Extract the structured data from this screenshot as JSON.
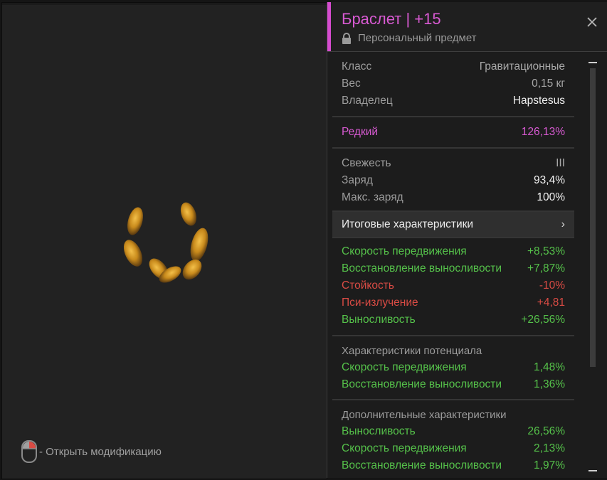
{
  "viewer": {
    "hint_text": "- Открыть модификацию"
  },
  "item": {
    "title": "Браслет | +15",
    "subtitle": "Персональный предмет"
  },
  "info": [
    {
      "label": "Класс",
      "value": "Гравитационные"
    },
    {
      "label": "Вес",
      "value": "0,15 кг"
    },
    {
      "label": "Владелец",
      "value": "Hapstesus"
    }
  ],
  "rarity": {
    "label": "Редкий",
    "value": "126,13%"
  },
  "condition": [
    {
      "label": "Свежесть",
      "value": "III"
    },
    {
      "label": "Заряд",
      "value": "93,4%"
    },
    {
      "label": "Макс. заряд",
      "value": "100%"
    }
  ],
  "totals_button": {
    "label": "Итоговые характеристики",
    "chevron": "›"
  },
  "stats": [
    {
      "label": "Скорость передвижения",
      "value": "+8,53%",
      "tone": "green"
    },
    {
      "label": "Восстановление выносливости",
      "value": "+7,87%",
      "tone": "green"
    },
    {
      "label": "Стойкость",
      "value": "-10%",
      "tone": "red"
    },
    {
      "label": "Пси-излучение",
      "value": "+4,81",
      "tone": "red"
    },
    {
      "label": "Выносливость",
      "value": "+26,56%",
      "tone": "green"
    }
  ],
  "potential": {
    "title": "Характеристики потенциала",
    "rows": [
      {
        "label": "Скорость передвижения",
        "value": "1,48%"
      },
      {
        "label": "Восстановление выносливости",
        "value": "1,36%"
      }
    ]
  },
  "additional": {
    "title": "Дополнительные характеристики",
    "rows": [
      {
        "label": "Выносливость",
        "value": "26,56%"
      },
      {
        "label": "Скорость передвижения",
        "value": "2,13%"
      },
      {
        "label": "Восстановление выносливости",
        "value": "1,97%"
      }
    ]
  },
  "colors": {
    "rarity": "#d85ad2",
    "positive": "#55c14a",
    "negative": "#d94b44"
  },
  "icons": {
    "lock": "lock-icon",
    "close": "close-icon",
    "mouse": "mouse-icon"
  }
}
